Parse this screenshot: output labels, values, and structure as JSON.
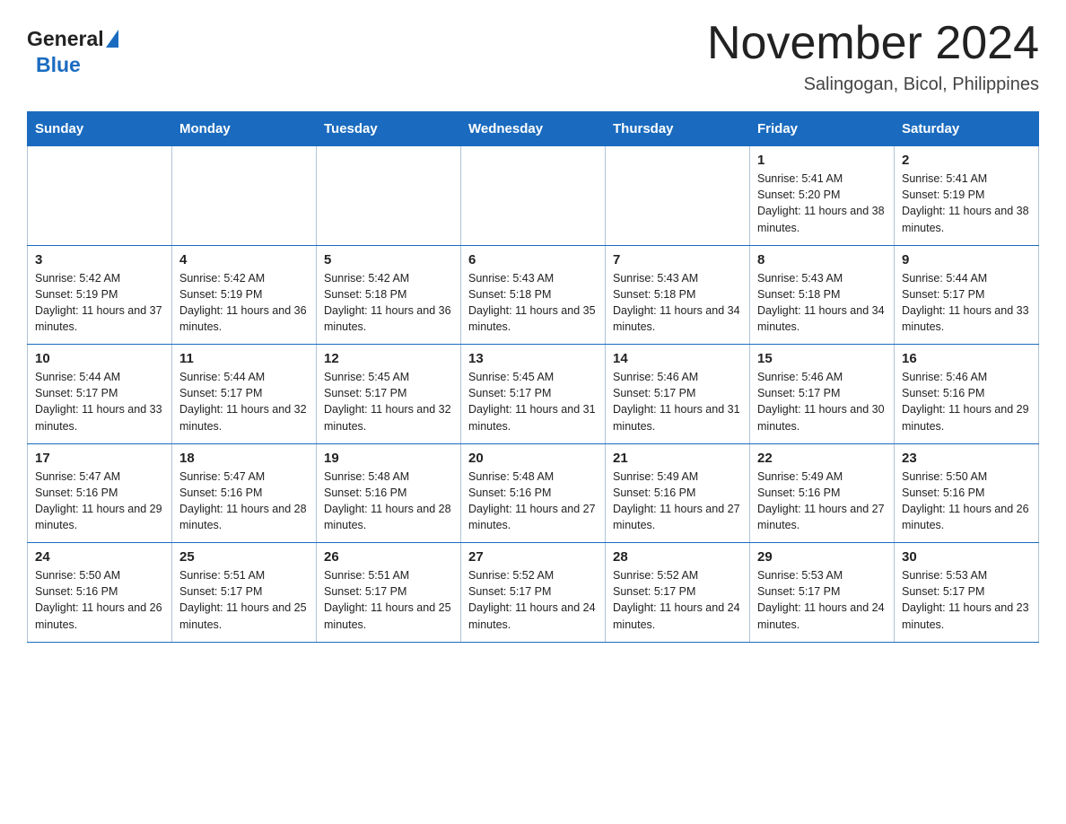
{
  "logo": {
    "general": "General",
    "blue": "Blue"
  },
  "header": {
    "title": "November 2024",
    "subtitle": "Salingogan, Bicol, Philippines"
  },
  "weekdays": [
    "Sunday",
    "Monday",
    "Tuesday",
    "Wednesday",
    "Thursday",
    "Friday",
    "Saturday"
  ],
  "weeks": [
    [
      {
        "day": "",
        "info": ""
      },
      {
        "day": "",
        "info": ""
      },
      {
        "day": "",
        "info": ""
      },
      {
        "day": "",
        "info": ""
      },
      {
        "day": "",
        "info": ""
      },
      {
        "day": "1",
        "info": "Sunrise: 5:41 AM\nSunset: 5:20 PM\nDaylight: 11 hours and 38 minutes."
      },
      {
        "day": "2",
        "info": "Sunrise: 5:41 AM\nSunset: 5:19 PM\nDaylight: 11 hours and 38 minutes."
      }
    ],
    [
      {
        "day": "3",
        "info": "Sunrise: 5:42 AM\nSunset: 5:19 PM\nDaylight: 11 hours and 37 minutes."
      },
      {
        "day": "4",
        "info": "Sunrise: 5:42 AM\nSunset: 5:19 PM\nDaylight: 11 hours and 36 minutes."
      },
      {
        "day": "5",
        "info": "Sunrise: 5:42 AM\nSunset: 5:18 PM\nDaylight: 11 hours and 36 minutes."
      },
      {
        "day": "6",
        "info": "Sunrise: 5:43 AM\nSunset: 5:18 PM\nDaylight: 11 hours and 35 minutes."
      },
      {
        "day": "7",
        "info": "Sunrise: 5:43 AM\nSunset: 5:18 PM\nDaylight: 11 hours and 34 minutes."
      },
      {
        "day": "8",
        "info": "Sunrise: 5:43 AM\nSunset: 5:18 PM\nDaylight: 11 hours and 34 minutes."
      },
      {
        "day": "9",
        "info": "Sunrise: 5:44 AM\nSunset: 5:17 PM\nDaylight: 11 hours and 33 minutes."
      }
    ],
    [
      {
        "day": "10",
        "info": "Sunrise: 5:44 AM\nSunset: 5:17 PM\nDaylight: 11 hours and 33 minutes."
      },
      {
        "day": "11",
        "info": "Sunrise: 5:44 AM\nSunset: 5:17 PM\nDaylight: 11 hours and 32 minutes."
      },
      {
        "day": "12",
        "info": "Sunrise: 5:45 AM\nSunset: 5:17 PM\nDaylight: 11 hours and 32 minutes."
      },
      {
        "day": "13",
        "info": "Sunrise: 5:45 AM\nSunset: 5:17 PM\nDaylight: 11 hours and 31 minutes."
      },
      {
        "day": "14",
        "info": "Sunrise: 5:46 AM\nSunset: 5:17 PM\nDaylight: 11 hours and 31 minutes."
      },
      {
        "day": "15",
        "info": "Sunrise: 5:46 AM\nSunset: 5:17 PM\nDaylight: 11 hours and 30 minutes."
      },
      {
        "day": "16",
        "info": "Sunrise: 5:46 AM\nSunset: 5:16 PM\nDaylight: 11 hours and 29 minutes."
      }
    ],
    [
      {
        "day": "17",
        "info": "Sunrise: 5:47 AM\nSunset: 5:16 PM\nDaylight: 11 hours and 29 minutes."
      },
      {
        "day": "18",
        "info": "Sunrise: 5:47 AM\nSunset: 5:16 PM\nDaylight: 11 hours and 28 minutes."
      },
      {
        "day": "19",
        "info": "Sunrise: 5:48 AM\nSunset: 5:16 PM\nDaylight: 11 hours and 28 minutes."
      },
      {
        "day": "20",
        "info": "Sunrise: 5:48 AM\nSunset: 5:16 PM\nDaylight: 11 hours and 27 minutes."
      },
      {
        "day": "21",
        "info": "Sunrise: 5:49 AM\nSunset: 5:16 PM\nDaylight: 11 hours and 27 minutes."
      },
      {
        "day": "22",
        "info": "Sunrise: 5:49 AM\nSunset: 5:16 PM\nDaylight: 11 hours and 27 minutes."
      },
      {
        "day": "23",
        "info": "Sunrise: 5:50 AM\nSunset: 5:16 PM\nDaylight: 11 hours and 26 minutes."
      }
    ],
    [
      {
        "day": "24",
        "info": "Sunrise: 5:50 AM\nSunset: 5:16 PM\nDaylight: 11 hours and 26 minutes."
      },
      {
        "day": "25",
        "info": "Sunrise: 5:51 AM\nSunset: 5:17 PM\nDaylight: 11 hours and 25 minutes."
      },
      {
        "day": "26",
        "info": "Sunrise: 5:51 AM\nSunset: 5:17 PM\nDaylight: 11 hours and 25 minutes."
      },
      {
        "day": "27",
        "info": "Sunrise: 5:52 AM\nSunset: 5:17 PM\nDaylight: 11 hours and 24 minutes."
      },
      {
        "day": "28",
        "info": "Sunrise: 5:52 AM\nSunset: 5:17 PM\nDaylight: 11 hours and 24 minutes."
      },
      {
        "day": "29",
        "info": "Sunrise: 5:53 AM\nSunset: 5:17 PM\nDaylight: 11 hours and 24 minutes."
      },
      {
        "day": "30",
        "info": "Sunrise: 5:53 AM\nSunset: 5:17 PM\nDaylight: 11 hours and 23 minutes."
      }
    ]
  ]
}
